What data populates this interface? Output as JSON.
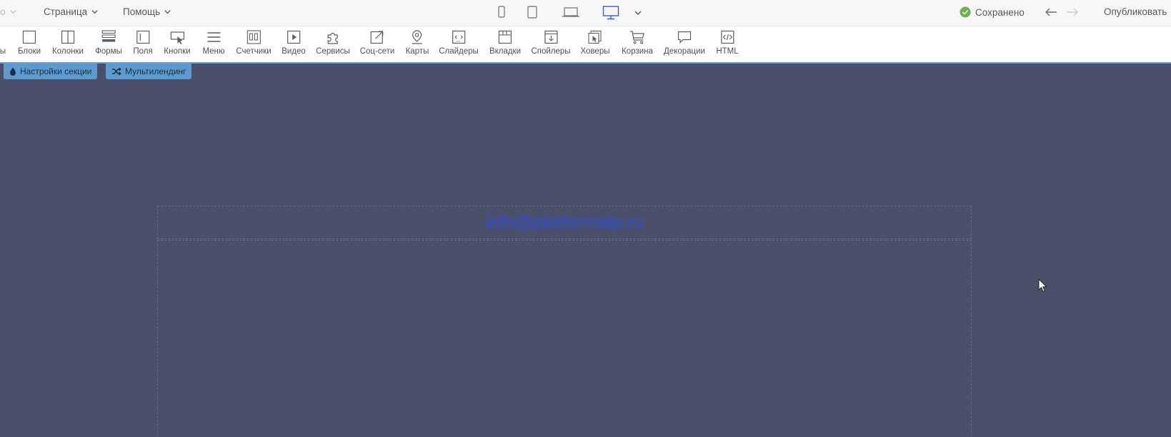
{
  "topbar": {
    "cut_left_label": "о",
    "page_menu": "Страница",
    "help_menu": "Помощь",
    "saved_status": "Сохранено",
    "publish_label": "Опубликовать",
    "active_device": "desktop",
    "accent_color": "#3b5fd6",
    "saved_color": "#6bb34a"
  },
  "toolbar": {
    "items": [
      {
        "id": "cut",
        "label": "ы"
      },
      {
        "id": "blocks",
        "label": "Блоки"
      },
      {
        "id": "columns",
        "label": "Колонки"
      },
      {
        "id": "forms",
        "label": "Формы"
      },
      {
        "id": "fields",
        "label": "Поля"
      },
      {
        "id": "buttons",
        "label": "Кнопки"
      },
      {
        "id": "menu",
        "label": "Меню"
      },
      {
        "id": "counters",
        "label": "Счетчики"
      },
      {
        "id": "video",
        "label": "Видео"
      },
      {
        "id": "services",
        "label": "Сервисы"
      },
      {
        "id": "social",
        "label": "Соц-сети"
      },
      {
        "id": "maps",
        "label": "Карты"
      },
      {
        "id": "sliders",
        "label": "Слайдеры"
      },
      {
        "id": "tabs",
        "label": "Вкладки"
      },
      {
        "id": "spoilers",
        "label": "Спойлеры"
      },
      {
        "id": "hovers",
        "label": "Ховеры"
      },
      {
        "id": "cart",
        "label": "Корзина"
      },
      {
        "id": "decorations",
        "label": "Декорации"
      },
      {
        "id": "html",
        "label": "HTML"
      }
    ]
  },
  "section": {
    "settings_label": "Настройки секции",
    "multilanding_label": "Мультилендинг",
    "email_text": "info@platformalp.ru",
    "background_color": "#4a5069"
  }
}
